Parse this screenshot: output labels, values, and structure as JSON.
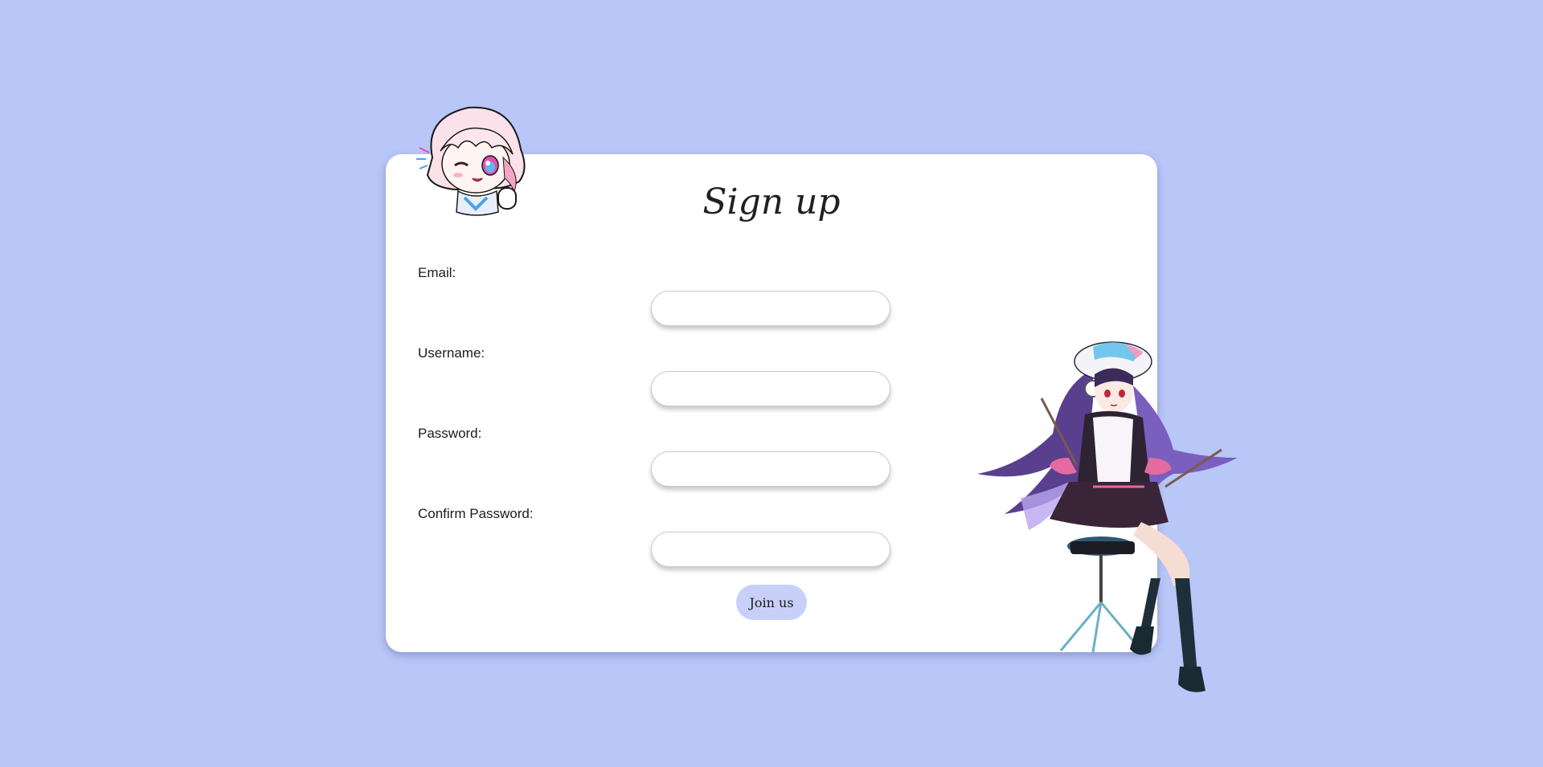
{
  "form": {
    "title": "Sign up",
    "fields": [
      {
        "label": "Email:",
        "value": "",
        "placeholder": ""
      },
      {
        "label": "Username:",
        "value": "",
        "placeholder": ""
      },
      {
        "label": "Password:",
        "value": "",
        "placeholder": ""
      },
      {
        "label": "Confirm Password:",
        "value": "",
        "placeholder": ""
      }
    ],
    "submit_label": "Join us"
  },
  "colors": {
    "background": "#b8c6f8",
    "card": "#ffffff",
    "button": "#c8d0f9"
  },
  "decorations": {
    "top_left": "chibi-pink-hair-character-illustration",
    "bottom_right": "drummer-girl-character-illustration"
  }
}
